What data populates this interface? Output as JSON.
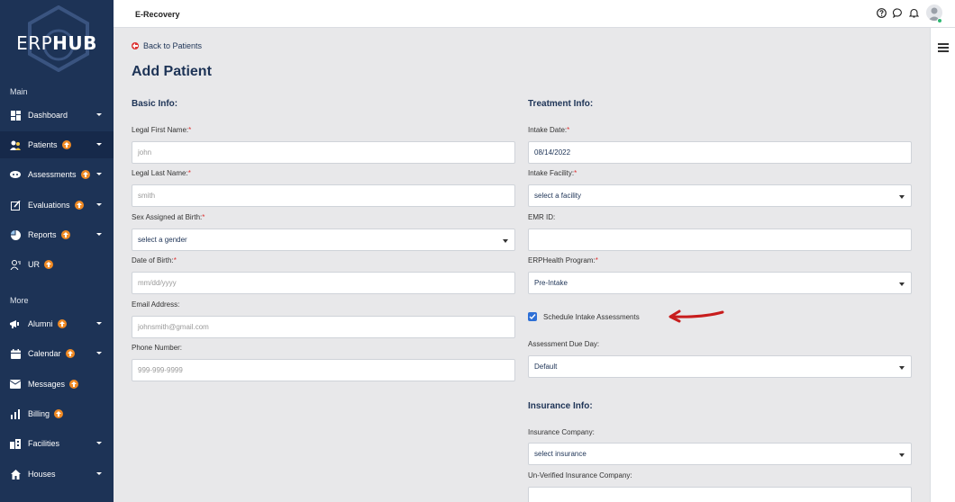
{
  "brand": {
    "logo_bold": "ERP",
    "logo_rest": "HUB"
  },
  "header": {
    "title": "E-Recovery"
  },
  "sidebar": {
    "main_label": "Main",
    "more_label": "More",
    "items": [
      {
        "label": "Dashboard",
        "icon": "dashboard-icon"
      },
      {
        "label": "Patients",
        "icon": "patients-icon"
      },
      {
        "label": "Assessments",
        "icon": "assessments-icon"
      },
      {
        "label": "Evaluations",
        "icon": "evaluations-icon"
      },
      {
        "label": "Reports",
        "icon": "reports-icon"
      },
      {
        "label": "UR",
        "icon": "ur-icon"
      },
      {
        "label": "Alumni",
        "icon": "alumni-icon"
      },
      {
        "label": "Calendar",
        "icon": "calendar-icon"
      },
      {
        "label": "Messages",
        "icon": "messages-icon"
      },
      {
        "label": "Billing",
        "icon": "billing-icon"
      },
      {
        "label": "Facilities",
        "icon": "facilities-icon"
      },
      {
        "label": "Houses",
        "icon": "houses-icon"
      }
    ]
  },
  "page": {
    "back_label": "Back to Patients",
    "title": "Add Patient"
  },
  "basic": {
    "section": "Basic Info:",
    "first_name_label": "Legal First Name:",
    "first_name_placeholder": "john",
    "last_name_label": "Legal Last Name:",
    "last_name_placeholder": "smith",
    "sex_label": "Sex Assigned at Birth:",
    "sex_value": "select a gender",
    "dob_label": "Date of Birth:",
    "dob_placeholder": "mm/dd/yyyy",
    "email_label": "Email Address:",
    "email_placeholder": "johnsmith@gmail.com",
    "phone_label": "Phone Number:",
    "phone_placeholder": "999-999-9999"
  },
  "treatment": {
    "section": "Treatment Info:",
    "intake_date_label": "Intake Date:",
    "intake_date_value": "08/14/2022",
    "facility_label": "Intake Facility:",
    "facility_value": "select a facility",
    "emr_label": "EMR ID:",
    "emr_value": "",
    "program_label": "ERPHealth Program:",
    "program_value": "Pre-Intake",
    "schedule_label": "Schedule Intake Assessments",
    "due_day_label": "Assessment Due Day:",
    "due_day_value": "Default"
  },
  "insurance": {
    "section": "Insurance Info:",
    "company_label": "Insurance Company:",
    "company_value": "select insurance",
    "unverified_label": "Un-Verified Insurance Company:",
    "unverified_value": ""
  },
  "colors": {
    "sidebar": "#1d3356",
    "accent": "#f08a24",
    "required": "#d33",
    "checkbox": "#2d6fd6",
    "annotation_arrow": "#c81d1d"
  }
}
